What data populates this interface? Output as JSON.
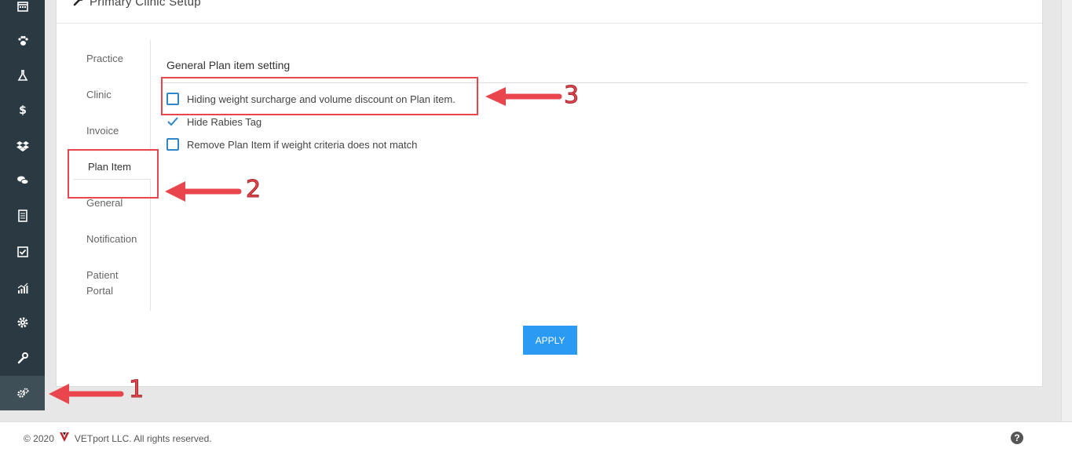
{
  "panel": {
    "title": "Primary Clinic Setup"
  },
  "tabs": [
    {
      "label": "Practice"
    },
    {
      "label": "Clinic"
    },
    {
      "label": "Invoice"
    },
    {
      "label": "Plan Item"
    },
    {
      "label": "General"
    },
    {
      "label": "Notification"
    },
    {
      "label": "Patient Portal"
    }
  ],
  "section": {
    "title": "General Plan item setting"
  },
  "options": [
    {
      "label": "Hiding weight surcharge and volume discount on Plan item.",
      "checked": false
    },
    {
      "label": "Hide Rabies Tag",
      "checked": true
    },
    {
      "label": "Remove Plan Item if weight criteria does not match",
      "checked": false
    }
  ],
  "apply_label": "APPLY",
  "annotations": {
    "n1": "1",
    "n2": "2",
    "n3": "3"
  },
  "footer": {
    "year": "© 2020",
    "company": "VETport LLC. All rights reserved."
  },
  "colors": {
    "sidebar": "#2b3a42",
    "accent": "#2b9af3",
    "annotation": "#e8454d"
  },
  "sidebar_icons": [
    "calendar-icon",
    "paw-icon",
    "flask-icon",
    "dollar-icon",
    "dropbox-icon",
    "chat-icon",
    "document-icon",
    "checklist-icon",
    "chart-icon",
    "gear-icon",
    "wrench-icon",
    "gears-icon"
  ]
}
